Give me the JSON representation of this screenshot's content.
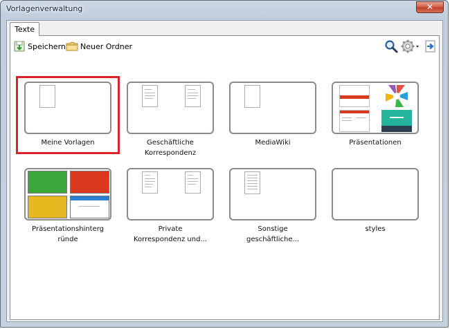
{
  "window": {
    "title": "Vorlagenverwaltung",
    "close_symbol": "✕"
  },
  "tabs": [
    {
      "label": "Texte"
    }
  ],
  "toolbar": {
    "save_label": "Speichern",
    "new_folder_label": "Neuer Ordner"
  },
  "folders": [
    {
      "line1": "Meine Vorlagen",
      "line2": "",
      "selected": true
    },
    {
      "line1": "Geschäftliche",
      "line2": "Korrespondenz",
      "selected": false
    },
    {
      "line1": "MediaWiki",
      "line2": "",
      "selected": false
    },
    {
      "line1": "Präsentationen",
      "line2": "",
      "selected": false
    },
    {
      "line1": "Präsentationshinterg",
      "line2": "ründe",
      "selected": false
    },
    {
      "line1": "Private",
      "line2": "Korrespondenz und...",
      "selected": false
    },
    {
      "line1": "Sonstige",
      "line2": "geschäftliche...",
      "selected": false
    },
    {
      "line1": "styles",
      "line2": "",
      "selected": false
    }
  ],
  "colors": {
    "selection": "#d9232a",
    "green": "#3aa83a",
    "red": "#d93a1e",
    "yellow": "#e8b820",
    "accent_blue": "#2a7fd0"
  }
}
